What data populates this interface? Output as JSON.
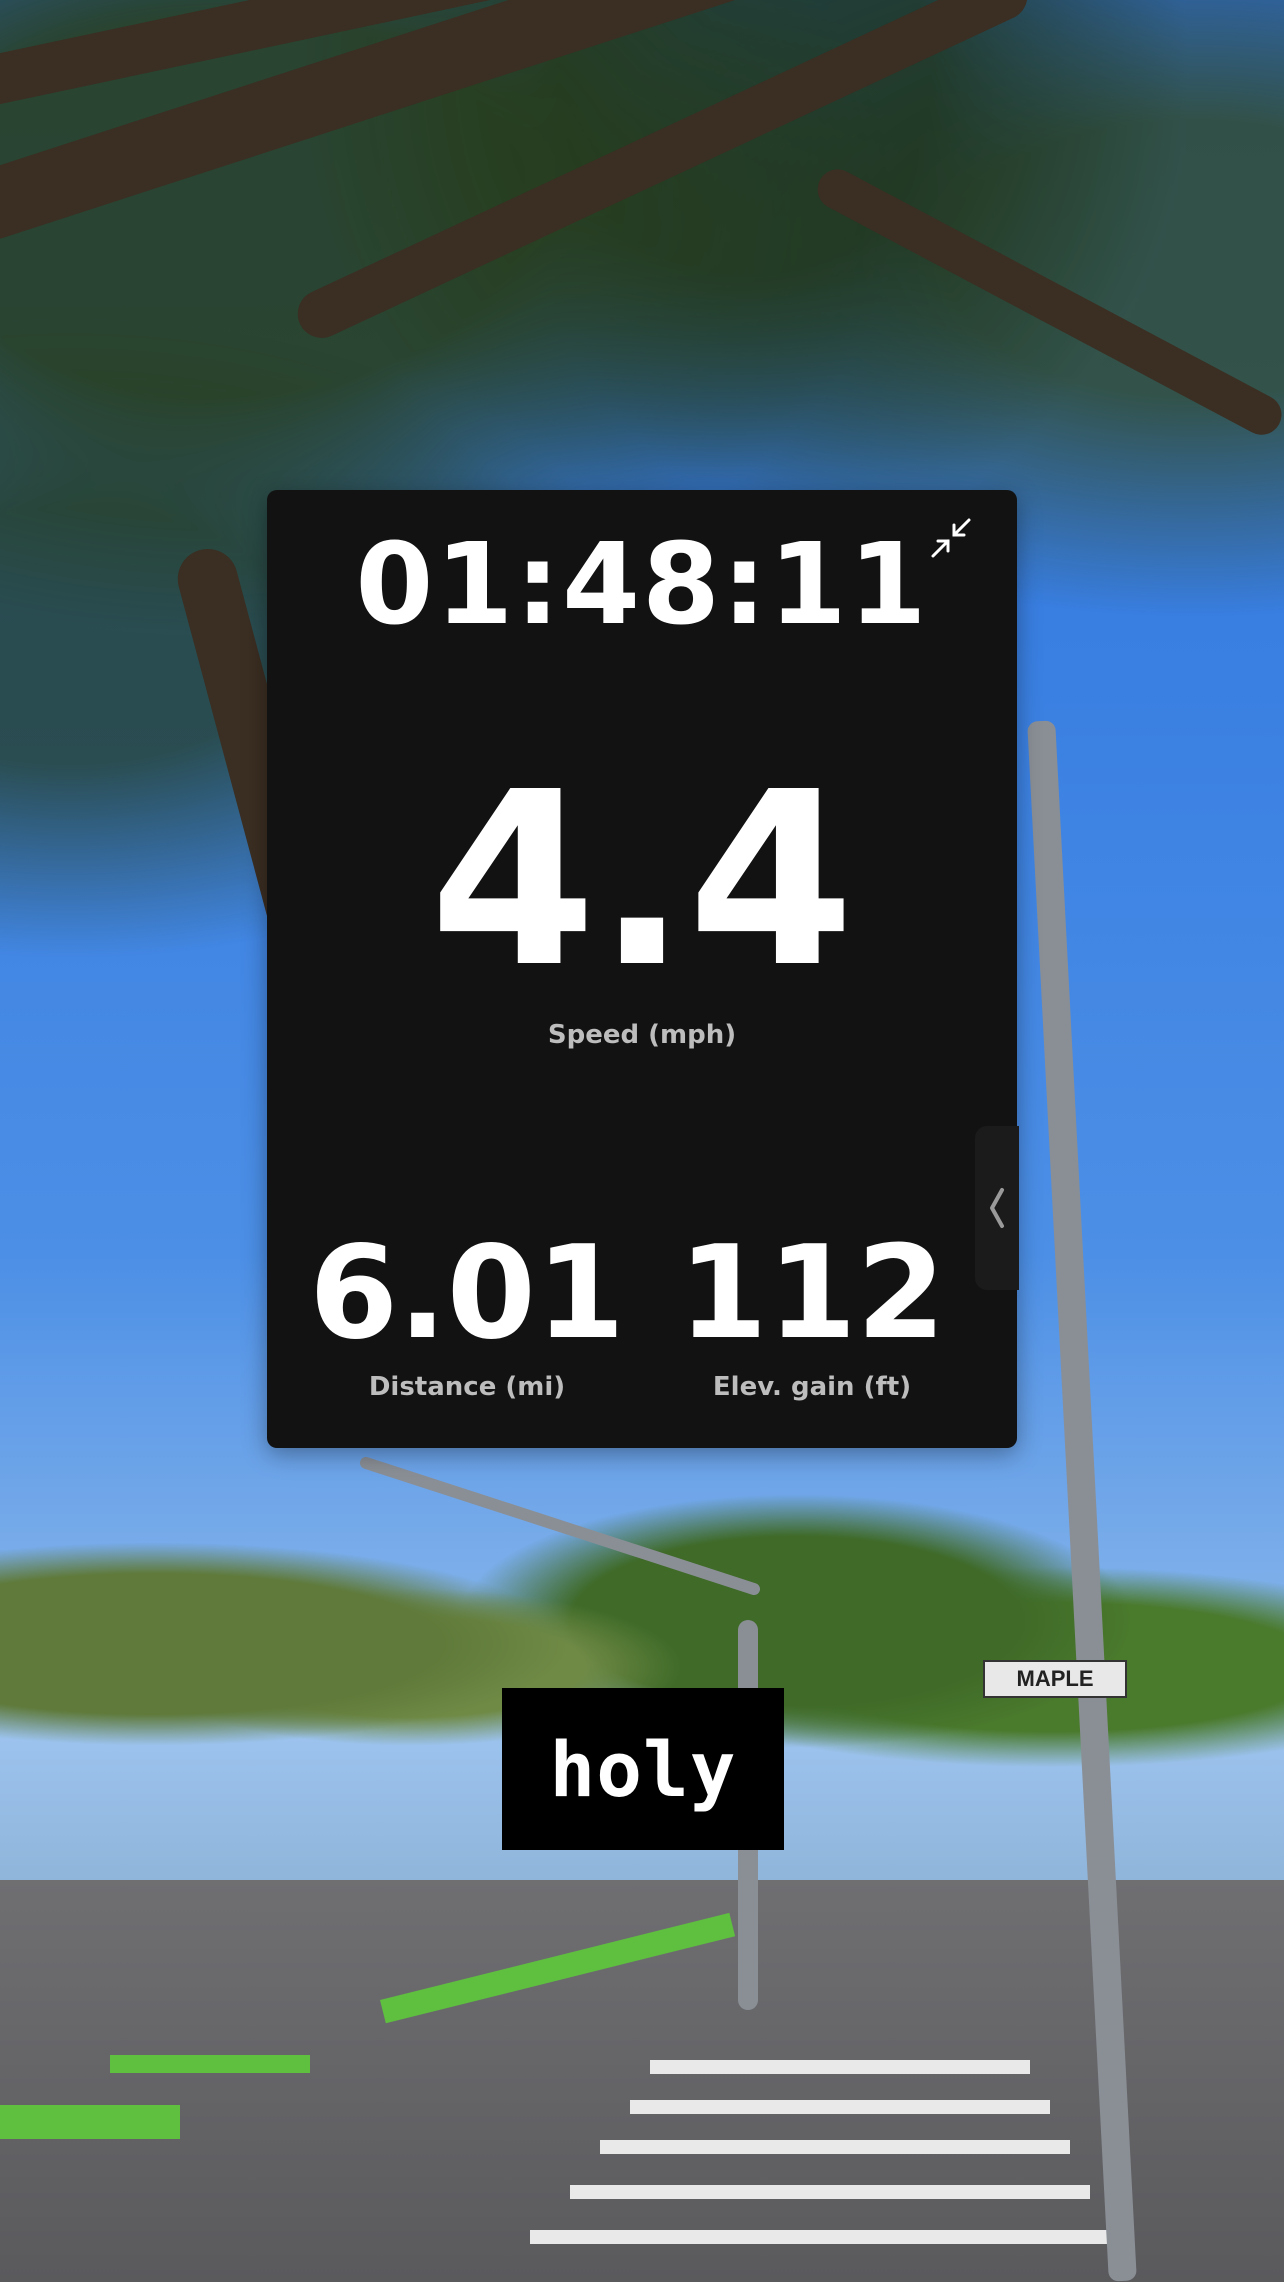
{
  "widget": {
    "elapsed_time": "01:48:11",
    "speed": {
      "value": "4.4",
      "label": "Speed (mph)"
    },
    "distance": {
      "value": "6.01",
      "label": "Distance (mi)"
    },
    "elevation_gain": {
      "value": "112",
      "label": "Elev. gain (ft)"
    },
    "collapse_icon": "collapse-arrows-icon",
    "side_handle_icon": "chevron-left-icon"
  },
  "caption": {
    "text": "holy"
  },
  "street_sign": {
    "text": "MAPLE"
  },
  "colors": {
    "widget_bg": "#121212",
    "text_primary": "#ffffff",
    "text_secondary": "#bdbdbd",
    "caption_bg": "#000000"
  }
}
